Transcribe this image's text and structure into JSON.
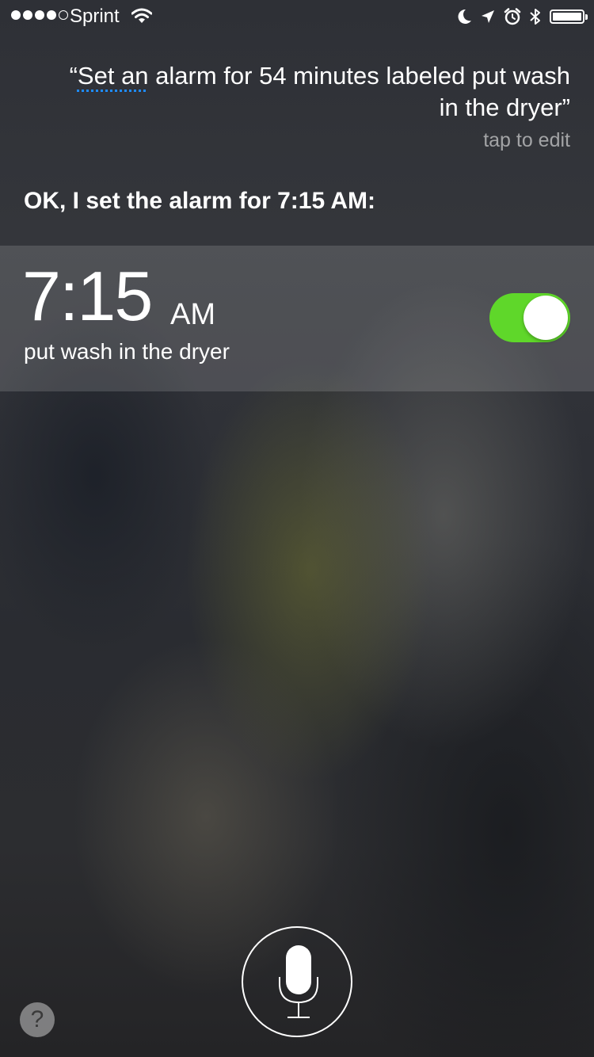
{
  "status_bar": {
    "carrier": "Sprint",
    "signal_bars_filled": 4,
    "signal_bars_total": 5,
    "icons": [
      "wifi-icon",
      "moon-icon",
      "location-arrow-icon",
      "alarm-clock-icon",
      "bluetooth-icon",
      "battery-icon"
    ],
    "battery_level": 1.0
  },
  "siri": {
    "query_open_quote": "“",
    "query_underlined": "Set an",
    "query_rest": " alarm for 54 minutes labeled put wash in the dryer”",
    "tap_to_edit": "tap to edit",
    "response": "OK, I set the alarm for 7:15 AM:"
  },
  "alarm": {
    "time": "7:15",
    "ampm": "AM",
    "label": "put wash in the dryer",
    "enabled": true,
    "toggle_color": "#5fd72a"
  },
  "controls": {
    "help_label": "?"
  },
  "colors": {
    "underline": "#1f8cff"
  }
}
